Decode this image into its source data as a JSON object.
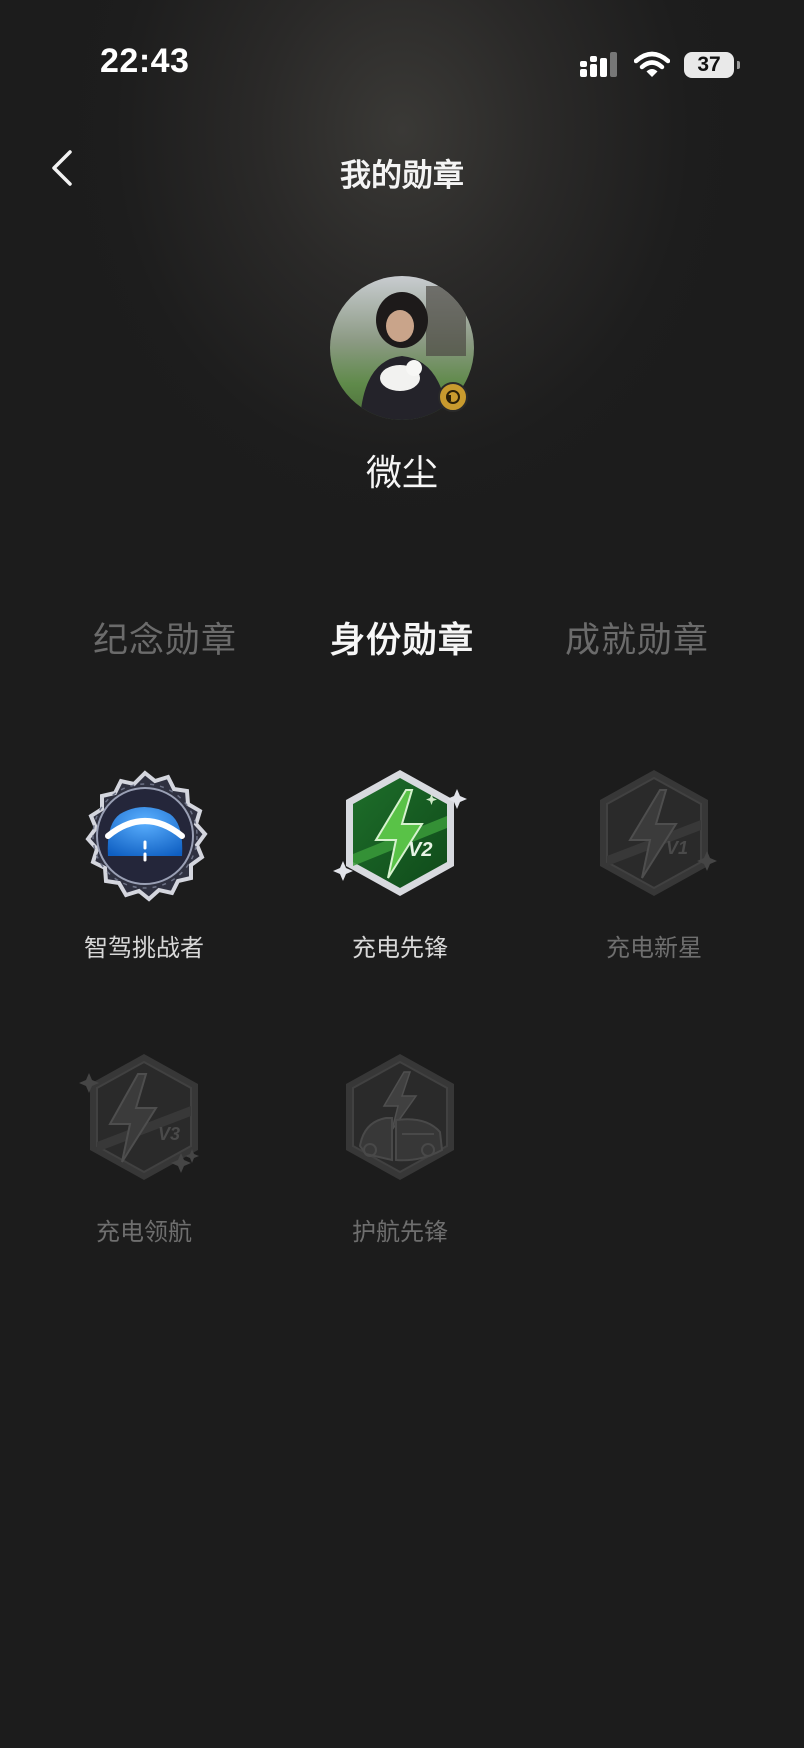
{
  "status_bar": {
    "time": "22:43",
    "battery": "37"
  },
  "header": {
    "title": "我的勋章"
  },
  "profile": {
    "username": "微尘"
  },
  "tabs": [
    {
      "label": "纪念勋章",
      "active": false
    },
    {
      "label": "身份勋章",
      "active": true
    },
    {
      "label": "成就勋章",
      "active": false
    }
  ],
  "badges": [
    {
      "label": "智驾挑战者",
      "unlocked": true,
      "icon": "smart-driving-badge-icon"
    },
    {
      "label": "充电先锋",
      "unlocked": true,
      "icon": "charging-v2-badge-icon"
    },
    {
      "label": "充电新星",
      "unlocked": false,
      "icon": "charging-v1-badge-icon"
    },
    {
      "label": "充电领航",
      "unlocked": false,
      "icon": "charging-v3-badge-icon"
    },
    {
      "label": "护航先锋",
      "unlocked": false,
      "icon": "escort-badge-icon"
    }
  ],
  "colors": {
    "background": "#1c1c1c",
    "active_tab": "#f6f6f6",
    "inactive_tab": "#6b6b6b",
    "badge_blue": "#1e7be0",
    "badge_green": "#2e8a3a",
    "avatar_badge": "#c89a2e"
  }
}
